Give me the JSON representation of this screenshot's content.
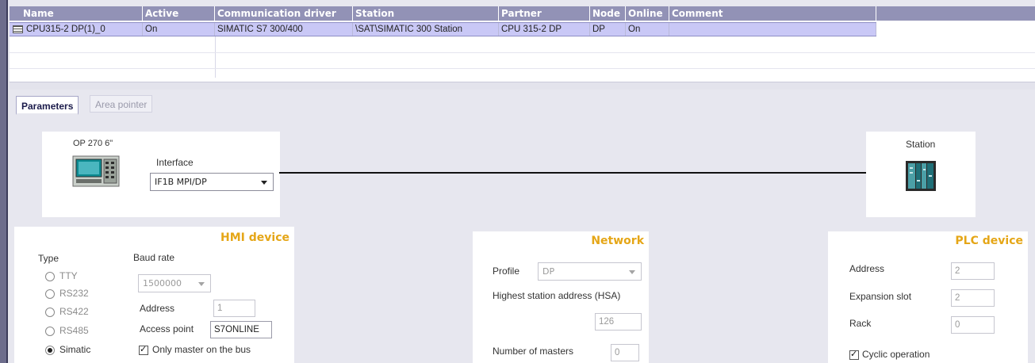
{
  "grid": {
    "columns": [
      "Name",
      "Active",
      "Communication driver",
      "Station",
      "Partner",
      "Node",
      "Online",
      "Comment"
    ],
    "row": [
      "CPU315-2 DP(1)_0",
      "On",
      "SIMATIC S7 300/400",
      "\\SAT\\SIMATIC 300 Station",
      "CPU 315-2 DP",
      "DP",
      "On",
      ""
    ]
  },
  "tabs": [
    "Parameters",
    "Area pointer"
  ],
  "topology": {
    "hmi_device_name": "OP 270 6\"",
    "interface_label": "Interface",
    "interface_value": "IF1B MPI/DP",
    "station_label": "Station"
  },
  "hmi": {
    "title": "HMI device",
    "type_label": "Type",
    "baud_label": "Baud rate",
    "baud_value": "1500000",
    "types": [
      "TTY",
      "RS232",
      "RS422",
      "RS485",
      "Simatic"
    ],
    "selected_type": "Simatic",
    "address_label": "Address",
    "address_value": "1",
    "access_point_label": "Access point",
    "access_point_value": "S7ONLINE",
    "only_master_label": "Only master on the bus",
    "only_master_checked": true
  },
  "network": {
    "title": "Network",
    "profile_label": "Profile",
    "profile_value": "DP",
    "hsa_label": "Highest station address (HSA)",
    "hsa_value": "126",
    "masters_label": "Number of masters",
    "masters_value": "0"
  },
  "plc": {
    "title": "PLC device",
    "address_label": "Address",
    "address_value": "2",
    "slot_label": "Expansion slot",
    "slot_value": "2",
    "rack_label": "Rack",
    "rack_value": "0",
    "cyclic_label": "Cyclic operation",
    "cyclic_checked": true
  },
  "colors": {
    "header_bg": "#9292b6",
    "selected_row": "#c9c8f6",
    "section_title": "#e5a617"
  }
}
